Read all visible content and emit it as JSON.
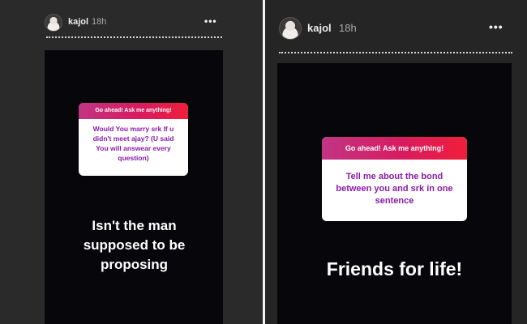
{
  "left": {
    "username": "kajol",
    "time": "18h",
    "menu": "•••",
    "question_prompt": "Go ahead! Ask me anything!",
    "question": "Would You marry srk If u didn't meet ajay? (U said You will answear every question)",
    "answer": "Isn't the man supposed to be proposing"
  },
  "right": {
    "username": "kajol",
    "time": "18h",
    "menu": "•••",
    "question_prompt": "Go ahead! Ask me anything!",
    "question": "Tell me about the bond between you and srk in one sentence",
    "answer": "Friends for life!"
  },
  "colors": {
    "question_header_start": "#c13584",
    "question_header_end": "#f01e3b",
    "question_text": "#8a1aa8",
    "story_background": "#07060a"
  }
}
